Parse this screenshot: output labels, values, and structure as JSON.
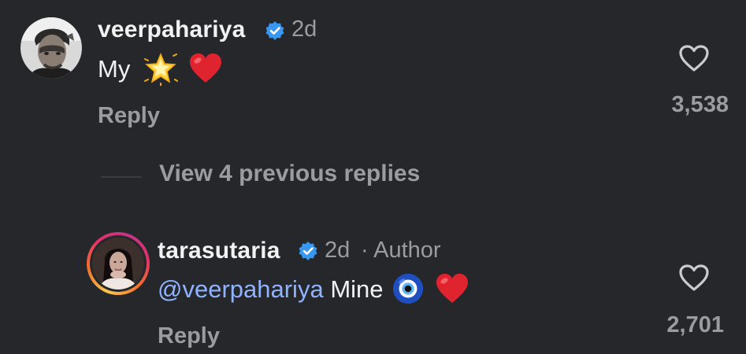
{
  "comments": [
    {
      "username": "veerpahariya",
      "verified": true,
      "age": "2d",
      "author_tag": "",
      "text": "My",
      "emojis": [
        "glowing-star",
        "red-heart"
      ],
      "reply_label": "Reply",
      "like_count": "3,538"
    },
    {
      "username": "tarasutaria",
      "verified": true,
      "age": "2d",
      "author_tag": "· Author",
      "mention": "@veerpahariya",
      "text": "Mine",
      "emojis": [
        "nazar-amulet",
        "red-heart"
      ],
      "reply_label": "Reply",
      "like_count": "2,701"
    }
  ],
  "thread": {
    "view_previous_label": "View 4 previous replies"
  },
  "colors": {
    "background": "#25272b",
    "primary_text": "#f2f2f2",
    "secondary_text": "#9a9ca1",
    "mention": "#8fb3ff",
    "verified_badge": "#3897f0",
    "heart": "#e0242f"
  }
}
